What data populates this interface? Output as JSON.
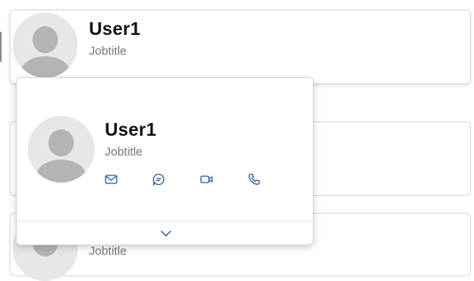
{
  "primary_card": {
    "name": "User1",
    "job_title": "Jobtitle"
  },
  "popup": {
    "name": "User1",
    "job_title": "Jobtitle",
    "actions": [
      "mail-icon",
      "chat-icon",
      "video-call-icon",
      "phone-icon"
    ],
    "expand_icon": "chevron-down-icon",
    "accent_color": "#2b5797"
  },
  "background_card_3": {
    "job_title": "Jobtitle"
  }
}
